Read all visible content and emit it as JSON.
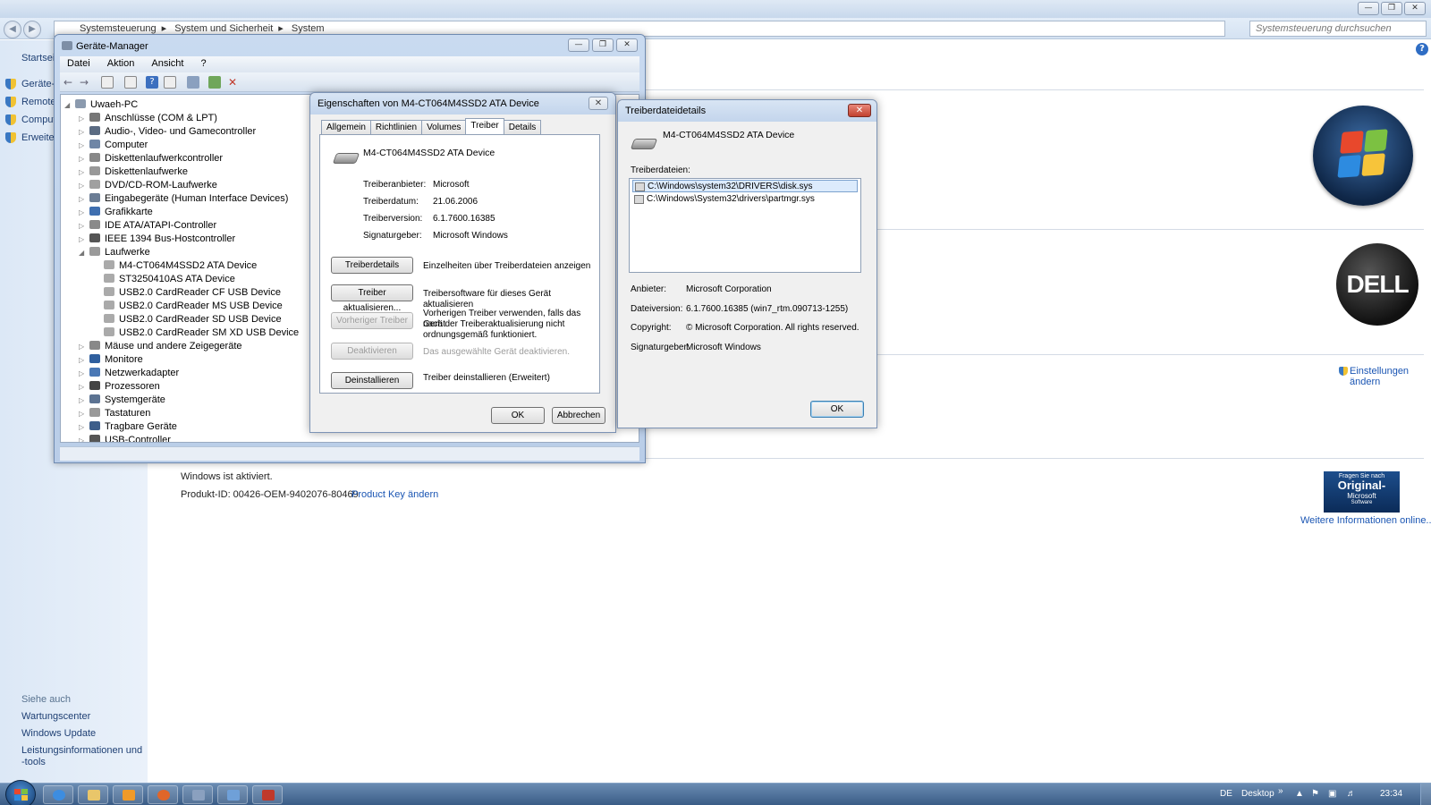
{
  "control_panel": {
    "breadcrumb": [
      "Systemsteuerung",
      "System und Sicherheit",
      "System"
    ],
    "search_placeholder": "Systemsteuerung durchsuchen",
    "left_tasks": [
      "Startseit",
      "Geräte-M",
      "Remote",
      "Comput",
      "Erweiter"
    ],
    "see_also_label": "Siehe auch",
    "see_also": [
      "Wartungscenter",
      "Windows Update",
      "Leistungsinformationen und",
      "-tools"
    ],
    "activated": "Windows ist aktiviert.",
    "product_id": "Produkt-ID: 00426-OEM-9402076-80469",
    "product_key_link": "Product Key ändern",
    "settings_link_1": "Einstellungen",
    "settings_link_2": "ändern",
    "genuine_small": "Fragen Sie nach",
    "genuine_big": "Original-",
    "genuine_ms": "Microsoft",
    "genuine_sw": "Software",
    "more_info_link": "Weitere Informationen online...",
    "dell_logo": "DELL"
  },
  "device_manager": {
    "title": "Geräte-Manager",
    "menu": [
      "Datei",
      "Aktion",
      "Ansicht",
      "?"
    ],
    "root": "Uwaeh-PC",
    "nodes": [
      "Anschlüsse (COM & LPT)",
      "Audio-, Video- und Gamecontroller",
      "Computer",
      "Diskettenlaufwerkcontroller",
      "Diskettenlaufwerke",
      "DVD/CD-ROM-Laufwerke",
      "Eingabegeräte (Human Interface Devices)",
      "Grafikkarte",
      "IDE ATA/ATAPI-Controller",
      "IEEE 1394 Bus-Hostcontroller",
      "Laufwerke",
      "Mäuse und andere Zeigegeräte",
      "Monitore",
      "Netzwerkadapter",
      "Prozessoren",
      "Systemgeräte",
      "Tastaturen",
      "Tragbare Geräte",
      "USB-Controller"
    ],
    "drives": [
      "M4-CT064M4SSD2 ATA Device",
      "ST3250410AS ATA Device",
      "USB2.0 CardReader CF USB Device",
      "USB2.0 CardReader MS USB Device",
      "USB2.0 CardReader SD USB Device",
      "USB2.0 CardReader SM XD USB Device"
    ]
  },
  "properties": {
    "title": "Eigenschaften von M4-CT064M4SSD2 ATA Device",
    "tabs": [
      "Allgemein",
      "Richtlinien",
      "Volumes",
      "Treiber",
      "Details"
    ],
    "active_tab": "Treiber",
    "device_name": "M4-CT064M4SSD2 ATA Device",
    "fields": [
      {
        "label": "Treiberanbieter:",
        "value": "Microsoft"
      },
      {
        "label": "Treiberdatum:",
        "value": "21.06.2006"
      },
      {
        "label": "Treiberversion:",
        "value": "6.1.7600.16385"
      },
      {
        "label": "Signaturgeber:",
        "value": "Microsoft Windows"
      }
    ],
    "buttons": [
      {
        "label": "Treiberdetails",
        "desc": "Einzelheiten über Treiberdateien anzeigen",
        "enabled": true
      },
      {
        "label": "Treiber aktualisieren...",
        "desc": "Treibersoftware für dieses Gerät aktualisieren",
        "enabled": true
      },
      {
        "label": "Vorheriger Treiber",
        "desc": "Vorherigen Treiber verwenden, falls das Gerät",
        "desc2": "nach der Treiberaktualisierung nicht",
        "desc3": "ordnungsgemäß funktioniert.",
        "enabled": false
      },
      {
        "label": "Deaktivieren",
        "desc": "Das ausgewählte Gerät deaktivieren.",
        "enabled": false
      },
      {
        "label": "Deinstallieren",
        "desc": "Treiber deinstallieren (Erweitert)",
        "enabled": true
      }
    ],
    "ok": "OK",
    "cancel": "Abbrechen"
  },
  "driver_details": {
    "title": "Treiberdateidetails",
    "device_name": "M4-CT064M4SSD2 ATA Device",
    "files_label": "Treiberdateien:",
    "files": [
      "C:\\Windows\\system32\\DRIVERS\\disk.sys",
      "C:\\Windows\\System32\\drivers\\partmgr.sys"
    ],
    "selected_file_index": 0,
    "fields": [
      {
        "label": "Anbieter:",
        "value": "Microsoft Corporation"
      },
      {
        "label": "Dateiversion:",
        "value": "6.1.7600.16385 (win7_rtm.090713-1255)"
      },
      {
        "label": "Copyright:",
        "value": "© Microsoft Corporation. All rights reserved."
      },
      {
        "label": "Signaturgeber:",
        "value": "Microsoft Windows"
      }
    ],
    "ok": "OK"
  },
  "taskbar": {
    "lang": "DE",
    "desktop": "Desktop",
    "time": "23:34"
  }
}
